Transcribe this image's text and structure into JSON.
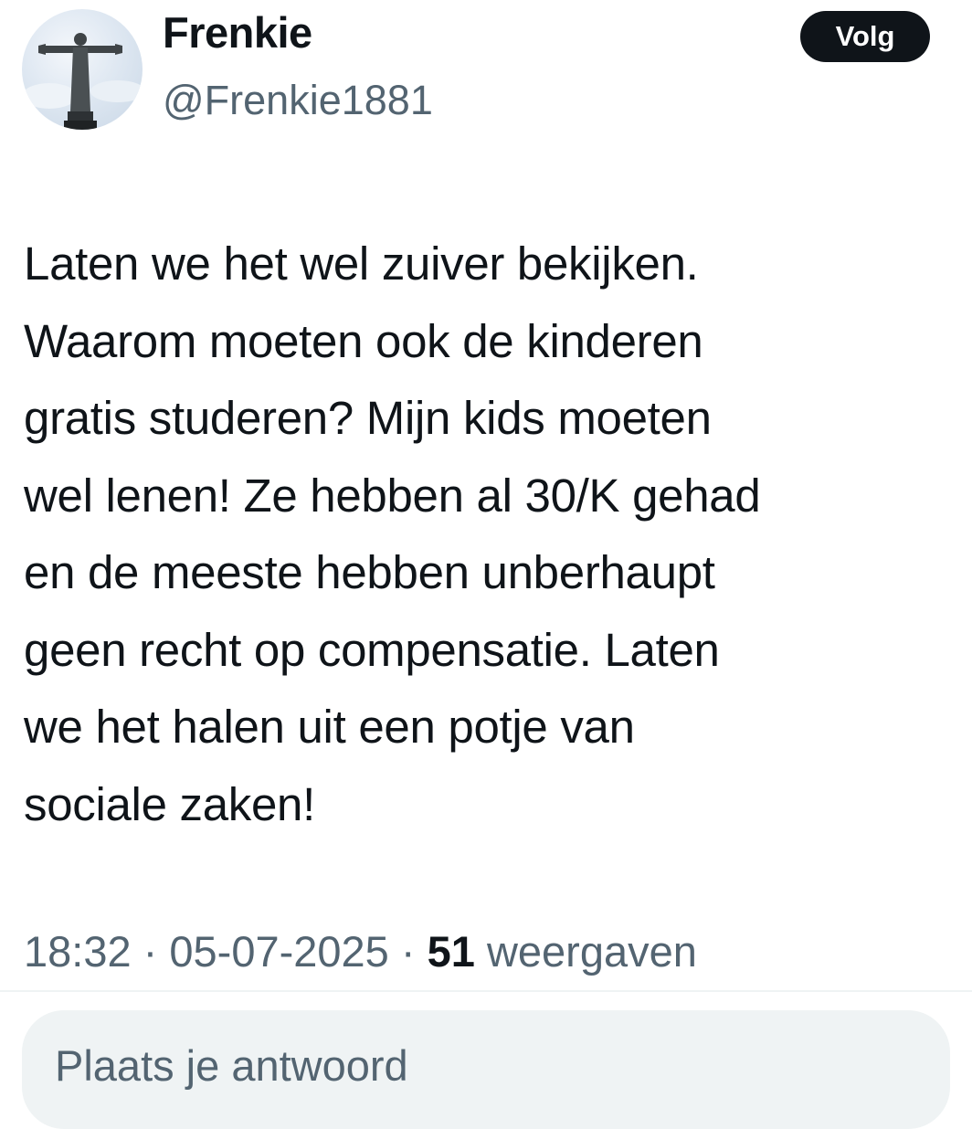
{
  "user": {
    "display_name": "Frenkie",
    "handle": "@Frenkie1881",
    "avatar_icon": "christ-the-redeemer-statue"
  },
  "follow_button": {
    "label": "Volg"
  },
  "tweet": {
    "lines": [
      "Laten we het wel zuiver bekijken.",
      "Waarom moeten ook de kinderen",
      "gratis studeren? Mijn kids moeten",
      "wel lenen! Ze hebben al 30/K gehad",
      "en de meeste hebben unberhaupt",
      "geen recht op compensatie. Laten",
      "we het halen uit een potje van",
      "sociale zaken!"
    ]
  },
  "meta": {
    "time": "18:32",
    "separator": " · ",
    "date": "05-07-2025",
    "views_count": "51",
    "views_label": " weergaven"
  },
  "reply": {
    "placeholder": "Plaats je antwoord"
  },
  "colors": {
    "text": "#0f1419",
    "secondary_text": "#536471",
    "button_bg": "#0f1419",
    "button_text": "#ffffff",
    "reply_bg": "#eff3f4"
  }
}
